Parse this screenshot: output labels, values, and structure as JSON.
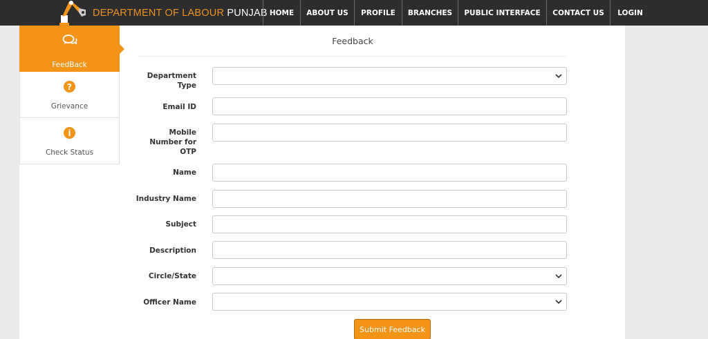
{
  "header": {
    "brand_primary": "DEPARTMENT OF LABOUR ",
    "brand_secondary": "PUNJAB",
    "nav": [
      {
        "label": "HOME",
        "icon": ""
      },
      {
        "label": "ABOUT US",
        "icon": ""
      },
      {
        "label": "PROFILE",
        "icon": ""
      },
      {
        "label": "BRANCHES",
        "icon": ""
      },
      {
        "label": "PUBLIC INTERFACE",
        "icon": ""
      },
      {
        "label": "CONTACT US",
        "icon": ""
      },
      {
        "label": "LOGIN",
        "icon": ""
      }
    ]
  },
  "sidebar": {
    "tabs": [
      {
        "label": "FeedBack",
        "icon": "chat-bubbles-icon",
        "active": true
      },
      {
        "label": "Grievance",
        "icon": "question-circle-icon",
        "active": false
      },
      {
        "label": "Check Status",
        "icon": "info-circle-icon",
        "active": false
      }
    ]
  },
  "form": {
    "title": "Feedback",
    "fields": {
      "department_type": {
        "label_lines": [
          "Department",
          "Type"
        ],
        "value": ""
      },
      "email": {
        "label": "Email ID",
        "value": ""
      },
      "mobile": {
        "label_lines": [
          "Mobile",
          "Number for",
          "OTP"
        ],
        "value": ""
      },
      "name": {
        "label": "Name",
        "value": ""
      },
      "industry": {
        "label": "Industry Name",
        "value": ""
      },
      "subject": {
        "label": "Subject",
        "value": ""
      },
      "description": {
        "label": "Description",
        "value": ""
      },
      "circle": {
        "label": "Circle/State",
        "value": ""
      },
      "officer": {
        "label": "Officer Name",
        "value": ""
      }
    },
    "submit_label": "Submit Feedback"
  },
  "colors": {
    "accent": "#f39419",
    "navbar": "#2d2d2d",
    "background": "#ebebeb"
  }
}
